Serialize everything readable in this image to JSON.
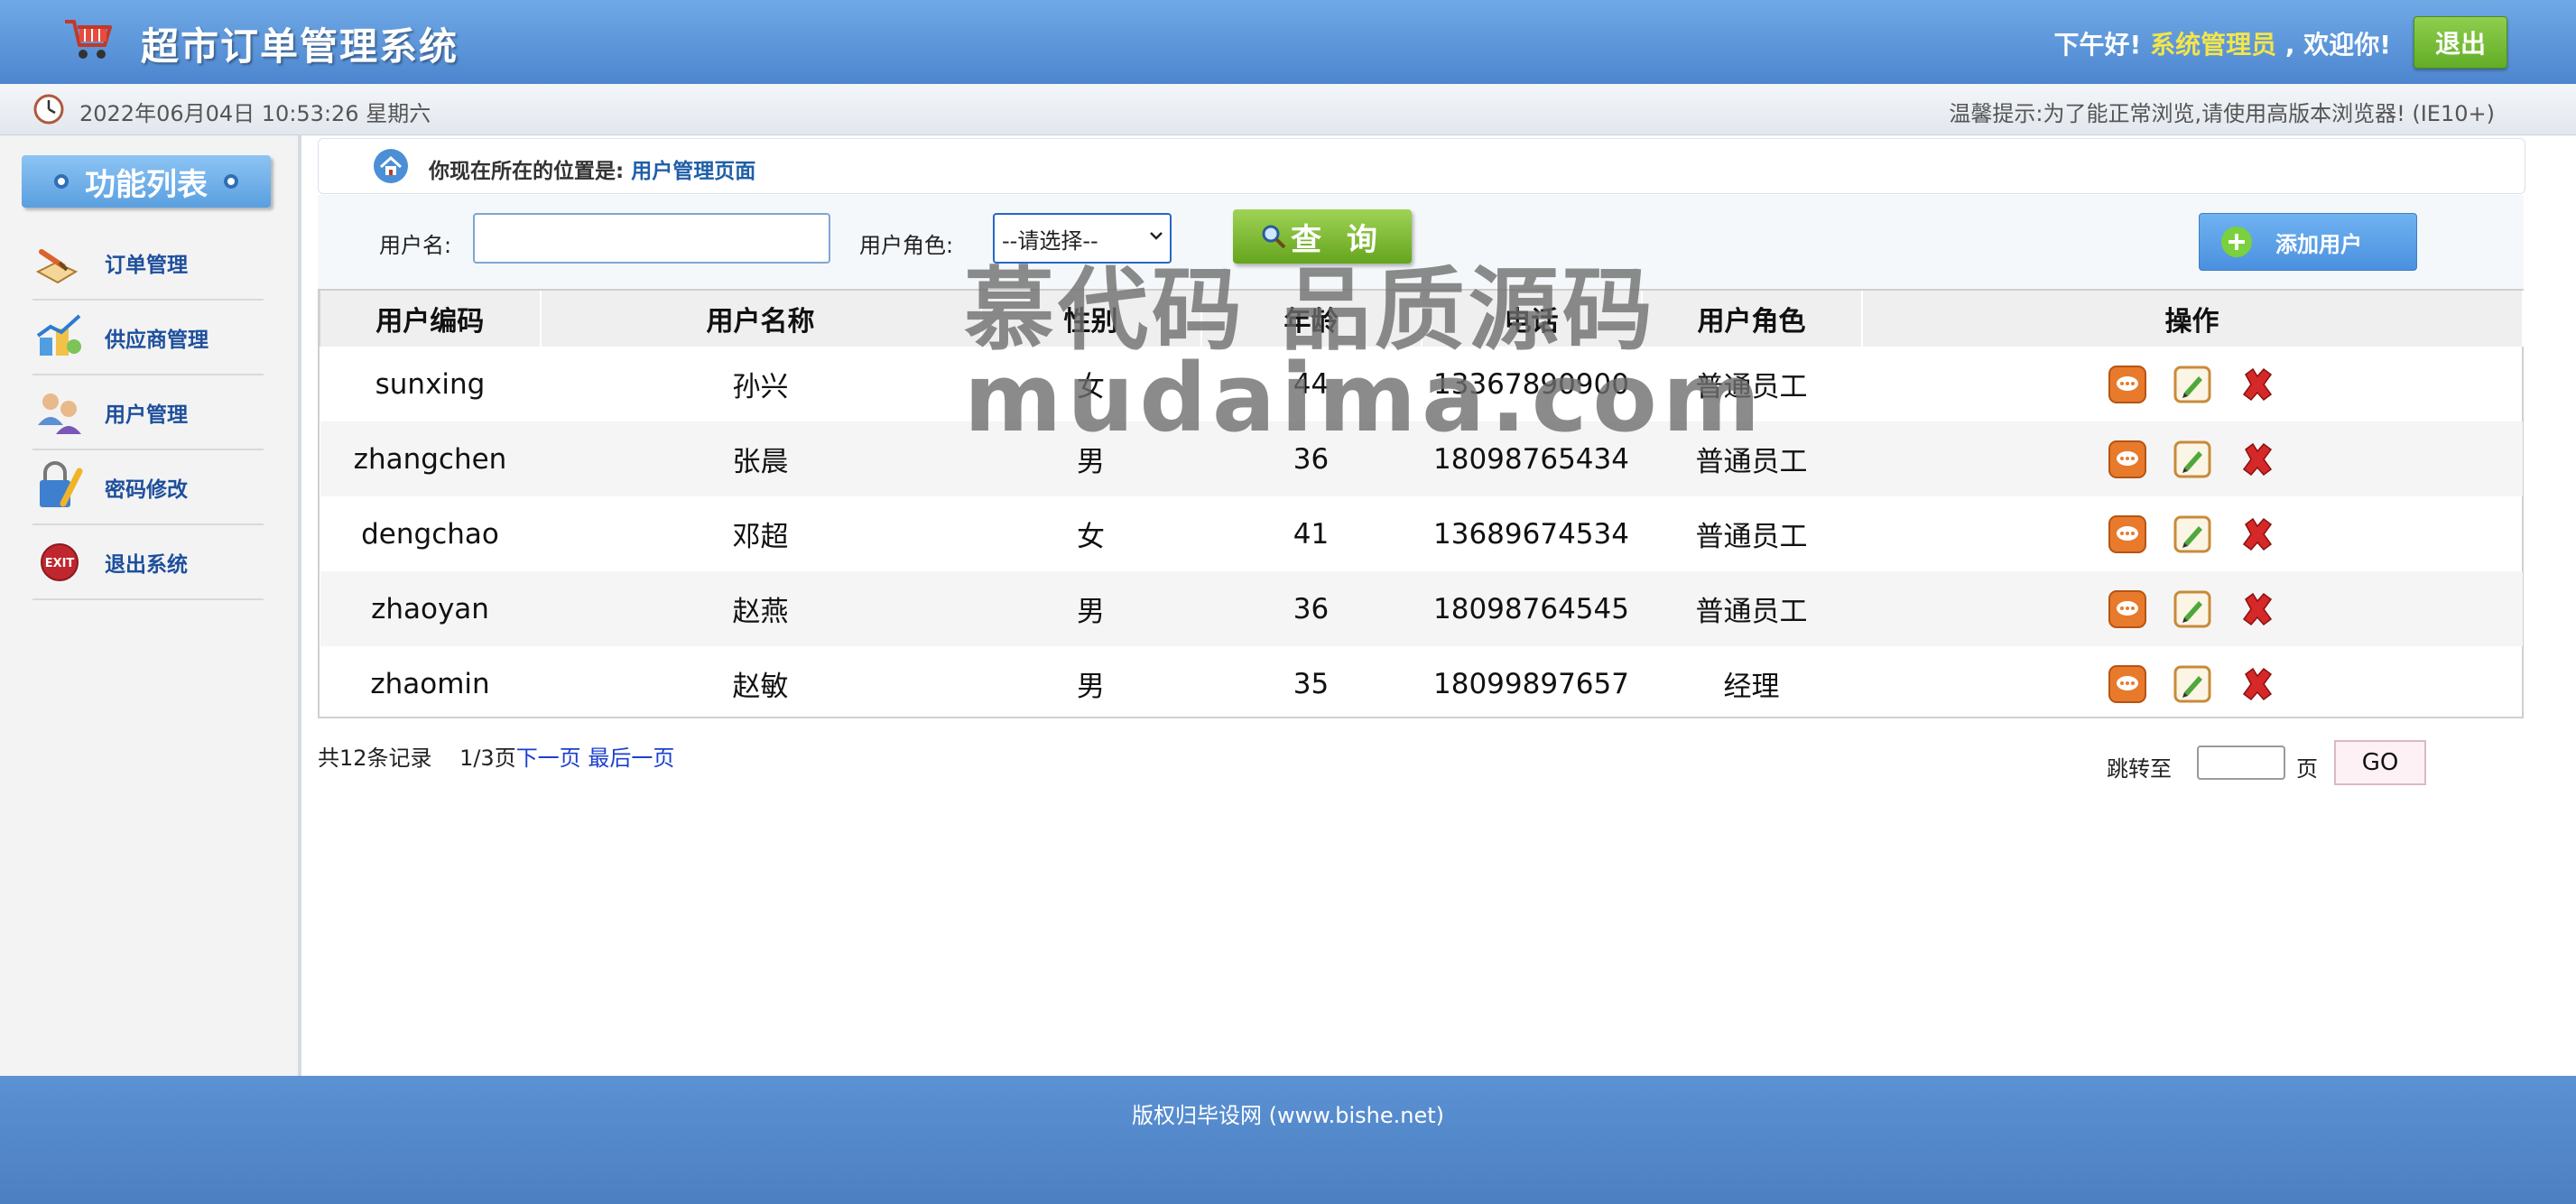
{
  "header": {
    "title": "超市订单管理系统",
    "greeting_prefix": "下午好!",
    "username": "系统管理员",
    "greeting_suffix": ", 欢迎你!",
    "logout_label": "退出"
  },
  "subbar": {
    "datetime": "2022年06月04日 10:53:26 星期六",
    "tip": "温馨提示:为了能正常浏览,请使用高版本浏览器! (IE10+)"
  },
  "sidebar": {
    "title": "功能列表",
    "items": [
      {
        "label": "订单管理",
        "icon": "order-icon"
      },
      {
        "label": "供应商管理",
        "icon": "supplier-icon"
      },
      {
        "label": "用户管理",
        "icon": "users-icon"
      },
      {
        "label": "密码修改",
        "icon": "password-icon"
      },
      {
        "label": "退出系统",
        "icon": "exit-icon"
      }
    ]
  },
  "location": {
    "prefix": "你现在所在的位置是:",
    "current": "用户管理页面"
  },
  "search": {
    "username_label": "用户名:",
    "username_value": "",
    "role_label": "用户角色:",
    "role_selected": "--请选择--",
    "query_label": "查 询",
    "add_label": "添加用户"
  },
  "table": {
    "headers": [
      "用户编码",
      "用户名称",
      "性别",
      "年龄",
      "电话",
      "用户角色",
      "操作"
    ],
    "rows": [
      {
        "code": "sunxing",
        "name": "孙兴",
        "gender": "女",
        "age": "44",
        "phone": "13367890900",
        "role": "普通员工"
      },
      {
        "code": "zhangchen",
        "name": "张晨",
        "gender": "男",
        "age": "36",
        "phone": "18098765434",
        "role": "普通员工"
      },
      {
        "code": "dengchao",
        "name": "邓超",
        "gender": "女",
        "age": "41",
        "phone": "13689674534",
        "role": "普通员工"
      },
      {
        "code": "zhaoyan",
        "name": "赵燕",
        "gender": "男",
        "age": "36",
        "phone": "18098764545",
        "role": "普通员工"
      },
      {
        "code": "zhaomin",
        "name": "赵敏",
        "gender": "男",
        "age": "35",
        "phone": "18099897657",
        "role": "经理"
      }
    ]
  },
  "pager": {
    "total": "共12条记录",
    "page": "1/3页",
    "next": "下一页",
    "last": "最后一页",
    "jump_label": "跳转至",
    "page_unit": "页",
    "go_label": "GO"
  },
  "footer": {
    "text": "版权归毕设网 (www.bishe.net)"
  },
  "watermark": {
    "line1": "慕代码 品质源码",
    "line2": "mudaima.com"
  }
}
